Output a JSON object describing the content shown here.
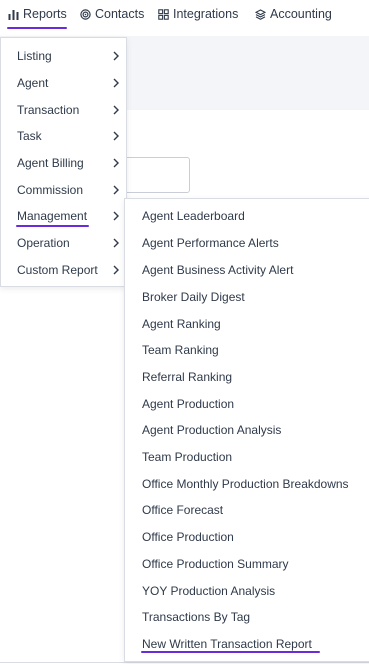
{
  "nav": {
    "items": [
      {
        "label": "Reports",
        "icon": "bar-chart-icon"
      },
      {
        "label": "Contacts",
        "icon": "target-icon"
      },
      {
        "label": "Integrations",
        "icon": "grid-icon"
      },
      {
        "label": "Accounting",
        "icon": "layers-icon"
      }
    ],
    "active": "Reports",
    "accent_color": "#6b2bd9"
  },
  "menu": {
    "items": [
      {
        "label": "Listing"
      },
      {
        "label": "Agent"
      },
      {
        "label": "Transaction"
      },
      {
        "label": "Task"
      },
      {
        "label": "Agent Billing"
      },
      {
        "label": "Commission"
      },
      {
        "label": "Management"
      },
      {
        "label": "Operation"
      },
      {
        "label": "Custom Report"
      }
    ],
    "active": "Management"
  },
  "submenu": {
    "items": [
      {
        "label": "Agent Leaderboard"
      },
      {
        "label": "Agent Performance Alerts"
      },
      {
        "label": "Agent Business Activity Alert"
      },
      {
        "label": "Broker Daily Digest"
      },
      {
        "label": "Agent Ranking"
      },
      {
        "label": "Team Ranking"
      },
      {
        "label": "Referral Ranking"
      },
      {
        "label": "Agent Production"
      },
      {
        "label": "Agent Production Analysis"
      },
      {
        "label": "Team Production"
      },
      {
        "label": "Office Monthly Production Breakdowns"
      },
      {
        "label": "Office Forecast"
      },
      {
        "label": "Office Production"
      },
      {
        "label": "Office Production Summary"
      },
      {
        "label": "YOY Production Analysis"
      },
      {
        "label": "Transactions By Tag"
      },
      {
        "label": "New Written Transaction Report"
      }
    ],
    "active": "New Written Transaction Report"
  }
}
